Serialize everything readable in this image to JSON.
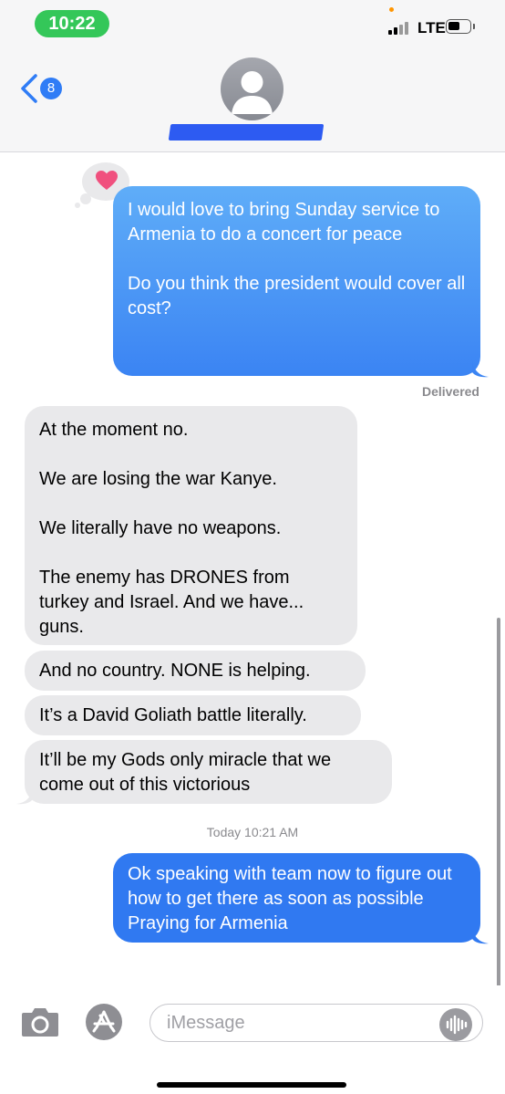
{
  "status_bar": {
    "time": "10:22",
    "network": "LTE"
  },
  "header": {
    "back_count": "8"
  },
  "messages": {
    "sent_1": "I would love to bring Sunday service to Armenia to do a concert for peace\n\nDo you think the president would cover all cost?",
    "delivered_label": "Delivered",
    "recv_1": "At the moment no.\n\nWe are losing the war Kanye.\n\nWe literally have no weapons.\n\nThe enemy has DRONES from turkey and Israel. And we have... guns.",
    "recv_2": "And no country. NONE is helping.",
    "recv_3": "It’s a David Goliath battle literally.",
    "recv_4": "It’ll be my Gods only miracle that we come out of this victorious",
    "timestamp": "Today 10:21 AM",
    "sent_2": "Ok speaking with team now to figure out how to get there as soon as possible    Praying for Armenia"
  },
  "composer": {
    "placeholder": "iMessage"
  },
  "colors": {
    "sent_bubble": "#3b84f3",
    "received_bubble": "#e9e9eb",
    "accent": "#2f7cf6",
    "heart": "#f0507e"
  },
  "icons": {
    "back": "chevron-left-icon",
    "avatar": "person-icon",
    "tapback": "heart-icon",
    "camera": "camera-icon",
    "apps": "app-store-icon",
    "audio": "waveform-icon"
  }
}
